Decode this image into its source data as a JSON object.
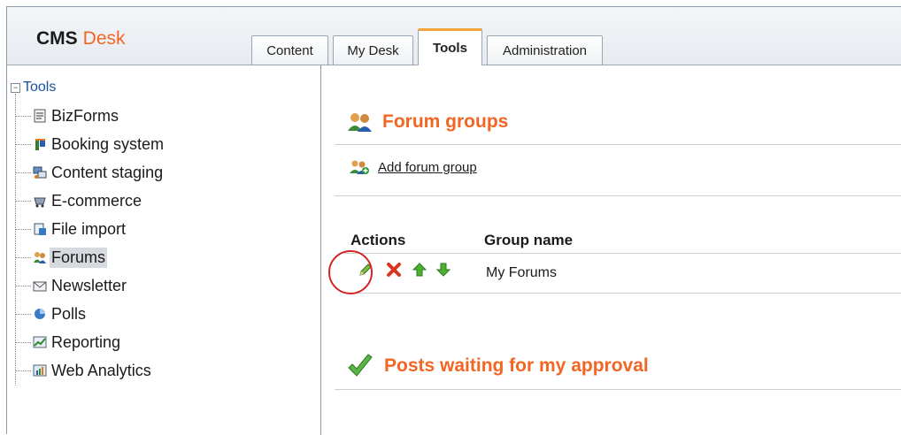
{
  "header": {
    "logo_part1": "CMS",
    "logo_part2": "Desk",
    "tabs": [
      {
        "label": "Content"
      },
      {
        "label": "My Desk"
      },
      {
        "label": "Tools"
      },
      {
        "label": "Administration"
      }
    ]
  },
  "sidebar": {
    "root_label": "Tools",
    "items": [
      {
        "label": "BizForms",
        "icon": "form-icon"
      },
      {
        "label": "Booking system",
        "icon": "booking-icon"
      },
      {
        "label": "Content staging",
        "icon": "staging-icon"
      },
      {
        "label": "E-commerce",
        "icon": "ecommerce-icon"
      },
      {
        "label": "File import",
        "icon": "file-import-icon"
      },
      {
        "label": "Forums",
        "icon": "forums-icon"
      },
      {
        "label": "Newsletter",
        "icon": "newsletter-icon"
      },
      {
        "label": "Polls",
        "icon": "polls-icon"
      },
      {
        "label": "Reporting",
        "icon": "reporting-icon"
      },
      {
        "label": "Web Analytics",
        "icon": "web-analytics-icon"
      }
    ]
  },
  "main": {
    "title": "Forum groups",
    "add_link": "Add forum group",
    "grid": {
      "col_actions": "Actions",
      "col_group_name": "Group name",
      "rows": [
        {
          "group_name": "My Forums"
        }
      ]
    },
    "section2_title": "Posts waiting for my approval"
  },
  "colors": {
    "accent": "#f26522",
    "tab_highlight": "#f2a33a",
    "link": "#1a4fa0",
    "annotation_circle": "#d42424"
  }
}
